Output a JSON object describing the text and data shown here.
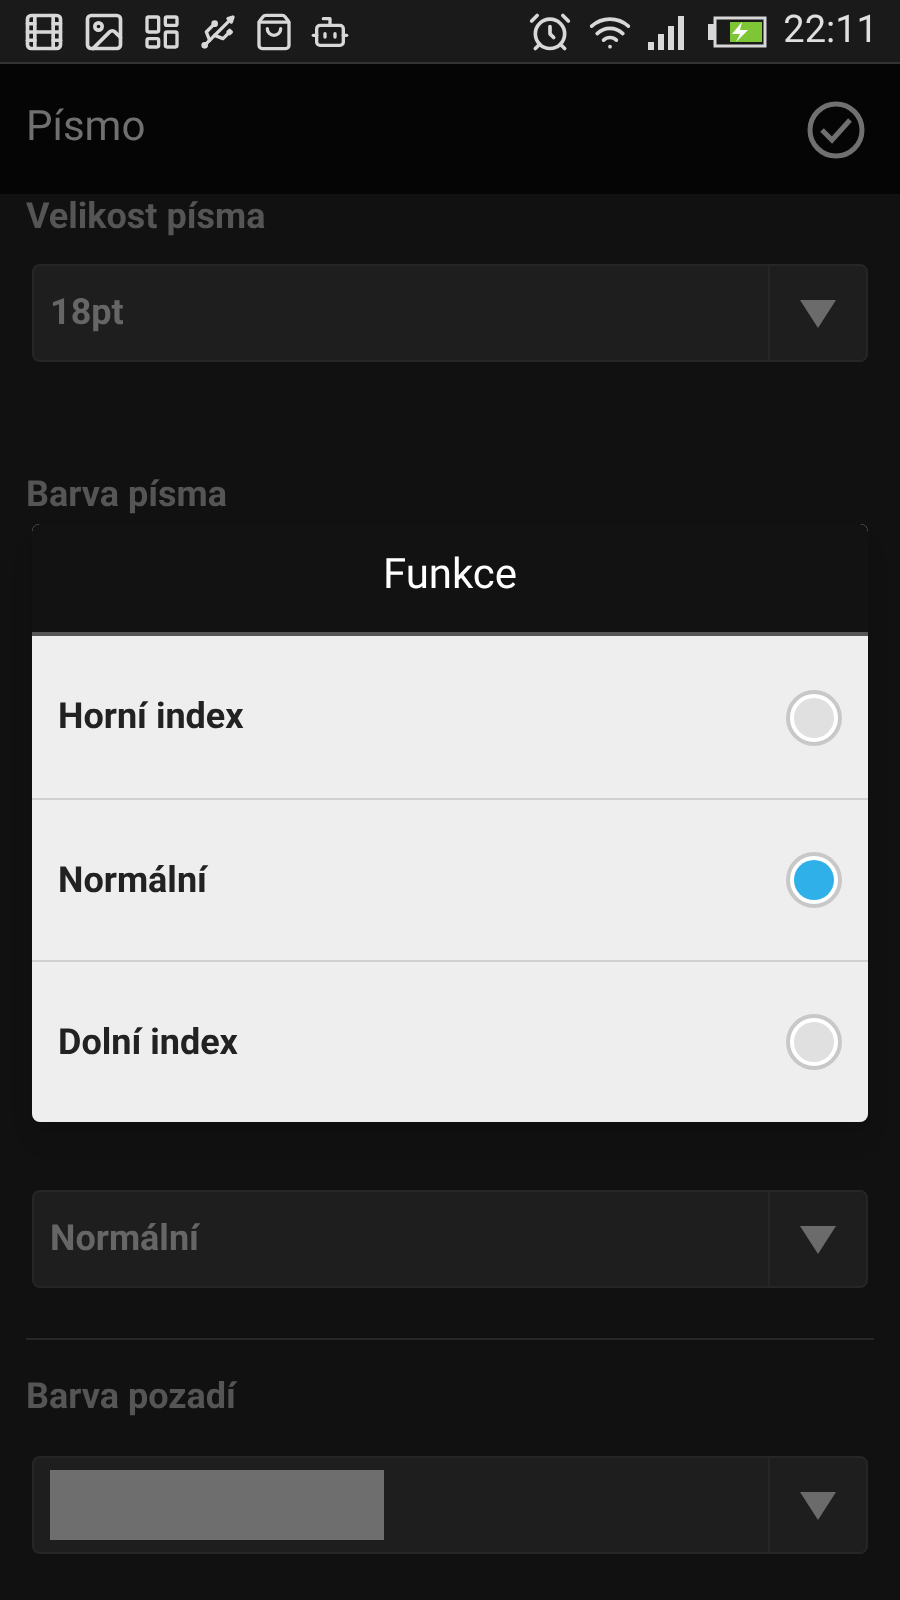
{
  "status_bar": {
    "time": "22:11"
  },
  "header": {
    "title": "Písmo"
  },
  "sections": [
    {
      "kind": "select",
      "label": "Velikost písma",
      "value": "18pt"
    },
    {
      "kind": "label",
      "label": "Barva písma"
    },
    {
      "kind": "gap"
    },
    {
      "kind": "select",
      "value": "Normální"
    },
    {
      "kind": "divider"
    },
    {
      "kind": "color",
      "label": "Barva pozadí",
      "color": "#6e6e6e"
    }
  ],
  "dialog": {
    "title": "Funkce",
    "options": [
      {
        "label": "Horní index",
        "selected": false
      },
      {
        "label": "Normální",
        "selected": true
      },
      {
        "label": "Dolní index",
        "selected": false
      }
    ]
  }
}
